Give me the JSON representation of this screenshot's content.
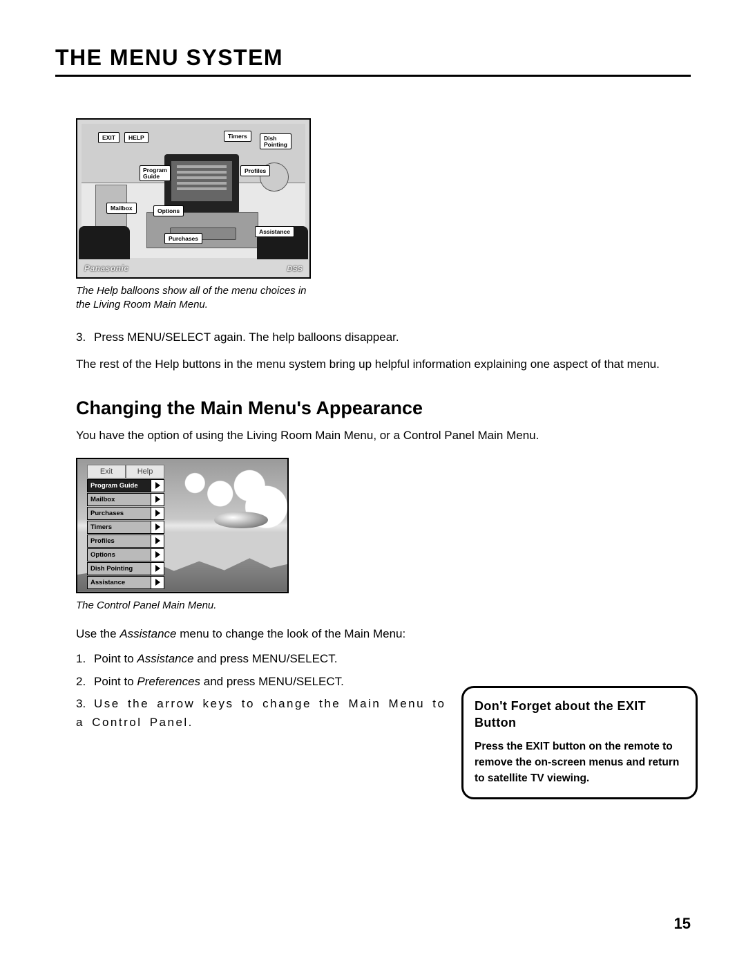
{
  "header": {
    "title": "THE MENU SYSTEM"
  },
  "fig1": {
    "caption": "The Help balloons show all of the menu choices in the Living Room Main Menu.",
    "labels": {
      "exit": "EXIT",
      "help": "HELP",
      "timers": "Timers",
      "dish": "Dish\nPointing",
      "program_guide": "Program\nGuide",
      "profiles": "Profiles",
      "mailbox": "Mailbox",
      "options": "Options",
      "purchases": "Purchases",
      "assistance": "Assistance"
    },
    "brand": "Panasonic",
    "logo_right": "DSS"
  },
  "body": {
    "step3_num": "3.",
    "step3": "Press MENU/SELECT again. The help balloons disappear.",
    "para1": "The rest of the Help buttons in the menu system bring up helpful information explaining one aspect of that menu.",
    "h2": "Changing the Main Menu's Appearance",
    "para2": "You have the option of using the Living Room Main Menu, or  a Control Panel Main Menu."
  },
  "fig2": {
    "caption": "The Control Panel Main Menu.",
    "top": {
      "exit": "Exit",
      "help": "Help"
    },
    "items": [
      "Program Guide",
      "Mailbox",
      "Purchases",
      "Timers",
      "Profiles",
      "Options",
      "Dish Pointing",
      "Assistance"
    ]
  },
  "list": {
    "intro_a": "Use the ",
    "intro_em": "Assistance",
    "intro_b": " menu to change the look of the Main Menu:",
    "i1n": "1.",
    "i1a": "Point to ",
    "i1em": "Assistance",
    "i1b": " and press MENU/SELECT.",
    "i2n": "2.",
    "i2a": "Point to ",
    "i2em": "Preferences",
    "i2b": " and press MENU/SELECT.",
    "i3n": "3.",
    "i3": "Use the arrow keys to change the Main Menu to a Control Panel."
  },
  "sidebar": {
    "title": "Don't Forget about the EXIT Button",
    "body": "Press the EXIT button on the remote to remove the on-screen menus and return to satellite TV viewing."
  },
  "page_number": "15"
}
